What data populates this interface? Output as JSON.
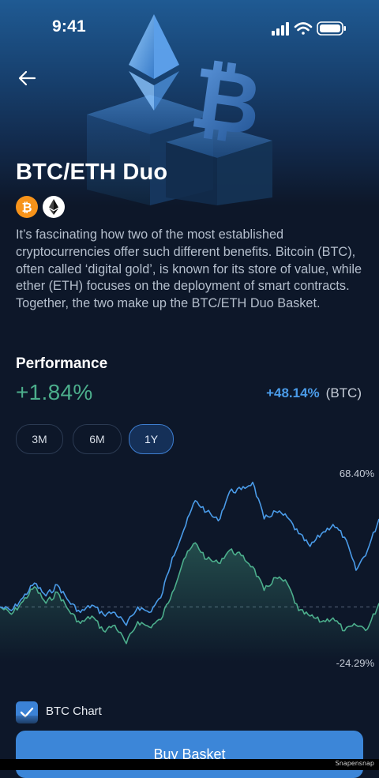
{
  "status_bar": {
    "time": "9:41"
  },
  "header": {
    "back_icon": "arrow-left-icon"
  },
  "basket": {
    "title": "BTC/ETH Duo",
    "coins": [
      {
        "name": "bitcoin",
        "icon": "bitcoin-icon",
        "color": "#f7931a"
      },
      {
        "name": "ethereum",
        "icon": "ethereum-icon",
        "color": "#ffffff"
      }
    ],
    "description": "It’s fascinating how two of the most established cryptocurrencies offer such different benefits. Bitcoin (BTC), often called ‘digital gold’, is known for its store of value, while ether (ETH) focuses on the deployment of smart contracts. Together, the two make up the BTC/ETH Duo Basket."
  },
  "performance": {
    "title": "Performance",
    "value": "+1.84%",
    "benchmark_value": "+48.14%",
    "benchmark_label": "(BTC)",
    "colors": {
      "basket": "#4cae8c",
      "benchmark": "#4a9be8"
    }
  },
  "tabs": [
    {
      "label": "3M",
      "active": false
    },
    {
      "label": "6M",
      "active": false
    },
    {
      "label": "1Y",
      "active": true
    }
  ],
  "chart_data": {
    "type": "line",
    "max_label": "68.40%",
    "min_label": "-24.29%",
    "ylim": [
      -30,
      70
    ],
    "series": [
      {
        "color": "#4a9be8",
        "values": [
          0,
          -2,
          5,
          13,
          6,
          12,
          3,
          -3,
          1,
          -4,
          -3,
          -10,
          0,
          -3,
          5,
          27,
          42,
          58,
          52,
          47,
          63,
          64,
          68,
          48,
          52,
          49,
          40,
          33,
          40,
          45,
          38,
          20,
          31,
          48
        ]
      },
      {
        "color": "#4cae8c",
        "values": [
          0,
          -4,
          3,
          11,
          2,
          8,
          -2,
          -9,
          -5,
          -13,
          -10,
          -20,
          -8,
          -11,
          -7,
          8,
          26,
          35,
          26,
          24,
          31,
          28,
          22,
          9,
          16,
          13,
          -2,
          -5,
          -8,
          -6,
          -13,
          -10,
          -12,
          2
        ]
      }
    ]
  },
  "toggle": {
    "label": "BTC Chart",
    "checked": true,
    "icon": "check-icon"
  },
  "actions": {
    "buy_label": "Buy Basket"
  },
  "watermark": "Snapensnap"
}
